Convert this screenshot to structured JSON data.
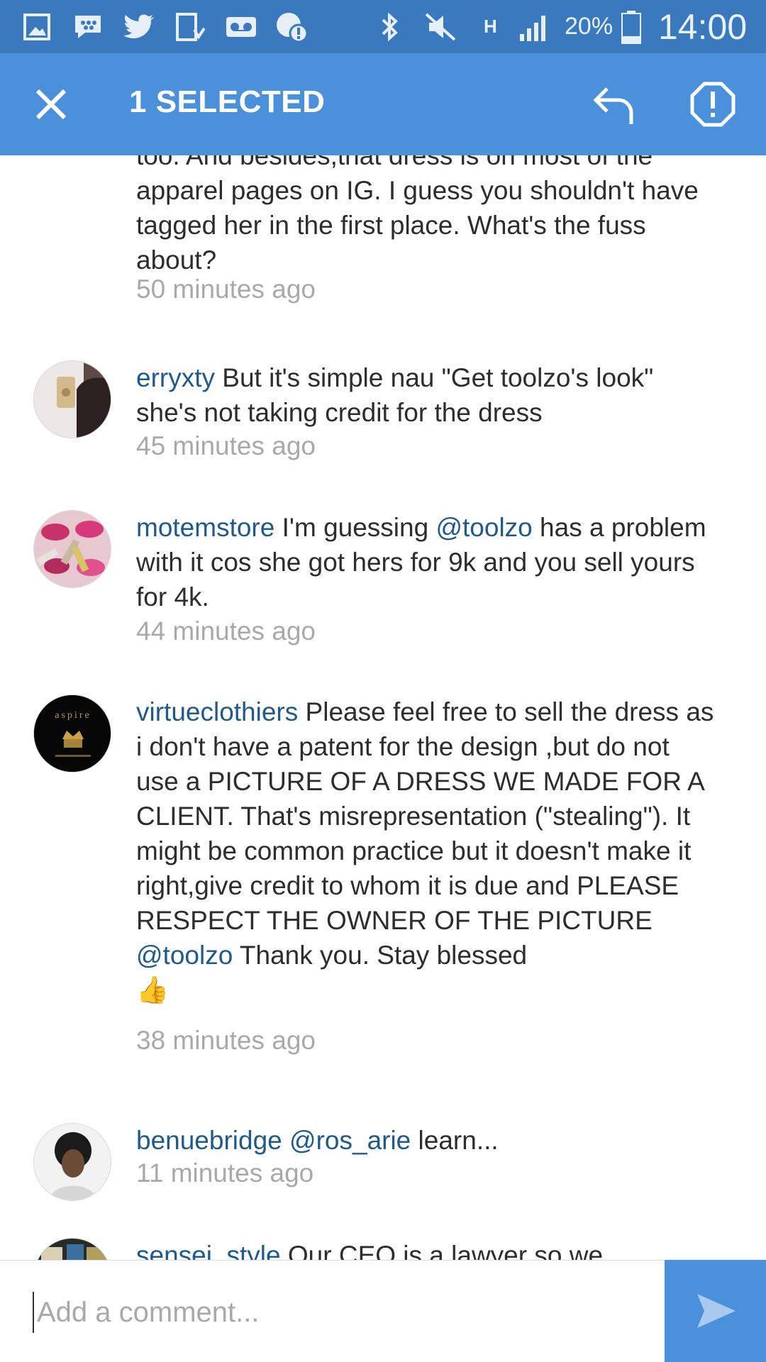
{
  "status_bar": {
    "battery": "20%",
    "time": "14:00",
    "network": "H"
  },
  "action_bar": {
    "title": "1 SELECTED"
  },
  "comments": [
    {
      "text": "too. And besides,that dress is on most of the apparel pages on IG. I guess you shouldn't have tagged her in the first place. What's the fuss about?",
      "time": "50 minutes ago"
    },
    {
      "username": "erryxty",
      "text": "But it's simple nau \"Get toolzo's look\" she's not taking credit for the dress",
      "time": "45 minutes ago"
    },
    {
      "username": "motemstore",
      "text_before": "I'm guessing",
      "mention": "@toolzo",
      "text_after": "has a problem with it cos she got hers for 9k and you sell yours for 4k.",
      "time": "44 minutes ago"
    },
    {
      "username": "virtueclothiers",
      "text_before": "Please feel free to sell the dress as i don't have a patent for the design ,but do not use a PICTURE OF A DRESS WE MADE FOR A CLIENT. That's misrepresentation (\"stealing\"). It might be common practice but it doesn't make it right,give credit to whom it is due and PLEASE RESPECT THE OWNER OF THE PICTURE",
      "mention": "@toolzo",
      "text_after": "Thank you. Stay blessed",
      "emoji": "👍",
      "avatar_text": "aspire",
      "time": "38 minutes ago"
    },
    {
      "username": "benuebridge",
      "mention": "@ros_arie",
      "text_after": "learn...",
      "time": "11 minutes ago"
    },
    {
      "username": "sensei_style",
      "text": "Our CEO is a lawyer so we"
    }
  ],
  "composer": {
    "placeholder": "Add a comment..."
  },
  "colors": {
    "status_bar": "#3a79bd",
    "action_bar": "#4a90da",
    "username": "#1f5a8c",
    "timestamp": "#a9a9a9"
  }
}
